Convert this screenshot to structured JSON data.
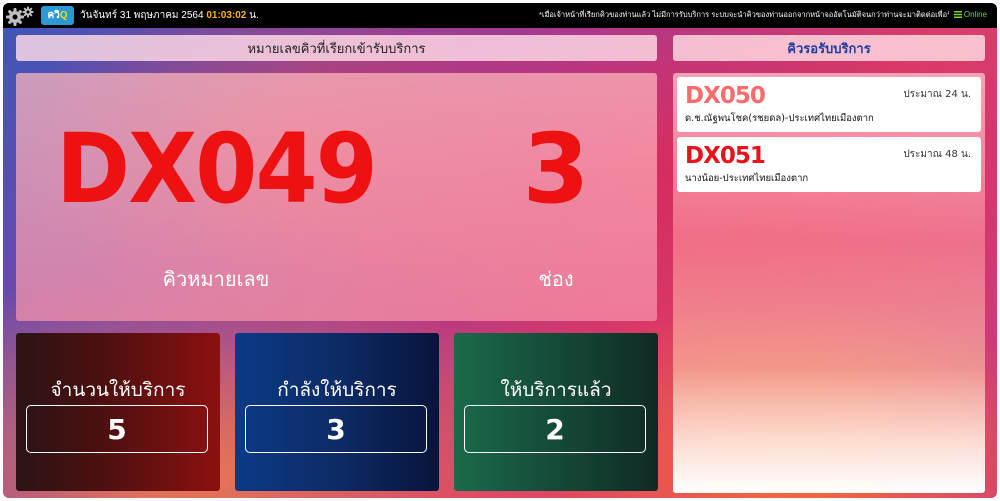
{
  "topbar": {
    "logo_text": "ควิ",
    "logo_q": "Q",
    "date": "วันจันทร์ 31 พฤษภาคม 2564",
    "time": "01:03:02",
    "time_unit": "น.",
    "marquee": "*เมื่อเจ้าหน้าที่เรียกคิวของท่านแล้ว ไม่มีการรับบริการ ระบบจะนำคิวของท่านออกจากหน้าจออัตโนมัติจนกว่าท่านจะมาติดต่อเพื่อรับคิวใ",
    "online_label": "Online",
    "colors": {
      "background": "#000000",
      "time": "#ffb21a",
      "online": "#7ccd2d"
    }
  },
  "main": {
    "header": "หมายเลขคิวที่เรียกเข้ารับบริการ",
    "queue_number": "DX049",
    "counter_number": "3",
    "queue_label": "คิวหมายเลข",
    "counter_label": "ช่อง",
    "accent_color": "#ee1111"
  },
  "stats": {
    "total": {
      "label": "จำนวนให้บริการ",
      "value": "5"
    },
    "serving": {
      "label": "กำลังให้บริการ",
      "value": "3"
    },
    "done": {
      "label": "ให้บริการแล้ว",
      "value": "2"
    }
  },
  "waiting": {
    "header": "คิวรอรับบริการ",
    "header_color": "#1e3f9e",
    "items": [
      {
        "code": "DX050",
        "time": "ประมาณ 24 น.",
        "name": "ด.ช.ณัฐพนโชค(รชยดล)-ประเทศไทยเมืองตาก",
        "color": "#ff6b6b"
      },
      {
        "code": "DX051",
        "time": "ประมาณ 48 น.",
        "name": "นางน้อย-ประเทศไทยเมืองตาก",
        "color": "#e8121a"
      }
    ]
  }
}
